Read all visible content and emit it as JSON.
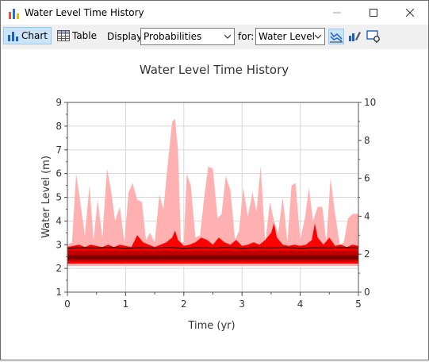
{
  "window": {
    "title": "Water Level Time History"
  },
  "toolbar": {
    "chart_label": "Chart",
    "table_label": "Table",
    "display_label": "Display:",
    "display_value": "Probabilities",
    "for_label": "for:",
    "for_value": "Water Level"
  },
  "chart_data": {
    "type": "area",
    "title": "Water Level Time History",
    "xlabel": "Time (yr)",
    "ylabel": "Water Level (m)",
    "xlim": [
      0,
      5
    ],
    "ylim": [
      1,
      9
    ],
    "y2lim": [
      0,
      10
    ],
    "xticks": [
      "0",
      "1",
      "2",
      "3",
      "4",
      "5"
    ],
    "yticks": [
      "1",
      "2",
      "3",
      "4",
      "5",
      "6",
      "7",
      "8",
      "9"
    ],
    "y2ticks": [
      "0",
      "2",
      "4",
      "6",
      "8",
      "10"
    ],
    "grid": true,
    "colors": {
      "outer_band": "#ffb0b0",
      "mid_band": "#ff0000",
      "inner_band": "#c00000",
      "core_band": "#7a0000",
      "median_line": "#000000"
    },
    "series": [
      {
        "band": "outer",
        "x": [
          0,
          0.08,
          0.15,
          0.22,
          0.3,
          0.38,
          0.45,
          0.52,
          0.6,
          0.68,
          0.75,
          0.82,
          0.9,
          0.98,
          1.05,
          1.12,
          1.2,
          1.28,
          1.35,
          1.42,
          1.5,
          1.58,
          1.65,
          1.72,
          1.8,
          1.85,
          1.9,
          1.95,
          2.0,
          2.05,
          2.12,
          2.2,
          2.28,
          2.35,
          2.42,
          2.5,
          2.58,
          2.65,
          2.72,
          2.8,
          2.88,
          2.95,
          3.02,
          3.1,
          3.18,
          3.25,
          3.32,
          3.4,
          3.48,
          3.55,
          3.62,
          3.7,
          3.78,
          3.85,
          3.92,
          4.0,
          4.08,
          4.15,
          4.22,
          4.3,
          4.38,
          4.45,
          4.52,
          4.6,
          4.68,
          4.75,
          4.82,
          4.9,
          5.0
        ],
        "upper": [
          3.0,
          3.1,
          6.0,
          4.8,
          3.4,
          5.5,
          3.2,
          4.9,
          3.3,
          6.2,
          5.3,
          4.0,
          4.6,
          3.1,
          5.2,
          5.6,
          4.9,
          4.8,
          3.2,
          3.5,
          3.1,
          5.1,
          4.5,
          6.3,
          8.2,
          8.3,
          7.0,
          3.1,
          3.1,
          6.0,
          5.5,
          3.3,
          3.4,
          5.0,
          6.3,
          6.2,
          4.1,
          4.3,
          5.9,
          5.3,
          3.2,
          3.6,
          5.4,
          4.2,
          5.2,
          4.4,
          6.3,
          3.1,
          4.8,
          4.0,
          3.5,
          5.0,
          3.1,
          5.5,
          5.6,
          3.2,
          4.1,
          5.4,
          4.0,
          4.6,
          4.6,
          3.1,
          5.8,
          4.3,
          3.0,
          3.1,
          4.1,
          4.3,
          4.3
        ],
        "lower": [
          2.1,
          2.1,
          2.1,
          2.1,
          2.1,
          2.1,
          2.1,
          2.1,
          2.1,
          2.1,
          2.1,
          2.1,
          2.1,
          2.1,
          2.1,
          2.1,
          2.1,
          2.1,
          2.1,
          2.1,
          2.1,
          2.1,
          2.1,
          2.1,
          2.1,
          2.1,
          2.1,
          2.1,
          2.1,
          2.1,
          2.1,
          2.1,
          2.1,
          2.1,
          2.1,
          2.1,
          2.1,
          2.1,
          2.1,
          2.1,
          2.1,
          2.1,
          2.1,
          2.1,
          2.1,
          2.1,
          2.1,
          2.1,
          2.1,
          2.1,
          2.1,
          2.1,
          2.1,
          2.1,
          2.1,
          2.1,
          2.1,
          2.1,
          2.1,
          2.1,
          2.1,
          2.1,
          2.1,
          2.1,
          2.1,
          2.1,
          2.1,
          2.1,
          2.1
        ]
      },
      {
        "band": "mid",
        "x": [
          0,
          0.1,
          0.2,
          0.3,
          0.4,
          0.5,
          0.6,
          0.7,
          0.8,
          0.9,
          1.0,
          1.1,
          1.2,
          1.3,
          1.4,
          1.5,
          1.6,
          1.7,
          1.8,
          1.85,
          1.9,
          2.0,
          2.1,
          2.2,
          2.3,
          2.4,
          2.5,
          2.6,
          2.7,
          2.8,
          2.9,
          3.0,
          3.1,
          3.2,
          3.3,
          3.4,
          3.5,
          3.55,
          3.6,
          3.7,
          3.8,
          3.9,
          4.0,
          4.1,
          4.2,
          4.25,
          4.3,
          4.4,
          4.5,
          4.6,
          4.7,
          4.8,
          4.9,
          5.0
        ],
        "upper": [
          2.9,
          2.95,
          3.0,
          2.9,
          3.0,
          2.95,
          2.9,
          3.0,
          2.9,
          3.0,
          2.95,
          2.9,
          3.4,
          3.1,
          3.0,
          2.9,
          3.0,
          3.1,
          3.3,
          3.6,
          3.2,
          2.95,
          3.0,
          3.1,
          3.3,
          3.2,
          3.0,
          3.3,
          3.1,
          3.0,
          3.2,
          2.95,
          3.0,
          3.1,
          3.0,
          3.2,
          3.5,
          3.9,
          3.3,
          3.0,
          2.95,
          3.0,
          2.95,
          3.0,
          3.2,
          3.9,
          3.3,
          3.0,
          3.3,
          2.95,
          3.0,
          2.9,
          3.0,
          2.95
        ],
        "lower": [
          2.2,
          2.2,
          2.2,
          2.2,
          2.2,
          2.2,
          2.2,
          2.2,
          2.2,
          2.2,
          2.2,
          2.2,
          2.2,
          2.2,
          2.2,
          2.2,
          2.2,
          2.2,
          2.2,
          2.2,
          2.2,
          2.2,
          2.2,
          2.2,
          2.2,
          2.2,
          2.2,
          2.2,
          2.2,
          2.2,
          2.2,
          2.2,
          2.2,
          2.2,
          2.2,
          2.2,
          2.2,
          2.2,
          2.2,
          2.2,
          2.2,
          2.2,
          2.2,
          2.2,
          2.2,
          2.2,
          2.2,
          2.2,
          2.2,
          2.2,
          2.2,
          2.2,
          2.2,
          2.2
        ]
      },
      {
        "band": "inner",
        "x": [
          0,
          0.5,
          1.0,
          1.5,
          2.0,
          2.5,
          3.0,
          3.5,
          4.0,
          4.5,
          5.0
        ],
        "upper": [
          2.75,
          2.75,
          2.75,
          2.75,
          2.75,
          2.75,
          2.75,
          2.75,
          2.75,
          2.75,
          2.75
        ],
        "lower": [
          2.3,
          2.3,
          2.3,
          2.3,
          2.3,
          2.3,
          2.3,
          2.3,
          2.3,
          2.3,
          2.3
        ]
      },
      {
        "band": "core",
        "x": [
          0,
          0.5,
          1.0,
          1.5,
          2.0,
          2.5,
          3.0,
          3.5,
          4.0,
          4.5,
          5.0
        ],
        "upper": [
          2.55,
          2.55,
          2.55,
          2.55,
          2.55,
          2.55,
          2.55,
          2.55,
          2.55,
          2.55,
          2.55
        ],
        "lower": [
          2.38,
          2.38,
          2.38,
          2.38,
          2.38,
          2.38,
          2.38,
          2.38,
          2.38,
          2.38,
          2.38
        ]
      },
      {
        "band": "median",
        "x": [
          0,
          0.25,
          0.5,
          0.75,
          1.0,
          1.25,
          1.5,
          1.75,
          2.0,
          2.25,
          2.5,
          2.75,
          3.0,
          3.25,
          3.5,
          3.75,
          4.0,
          4.25,
          4.5,
          4.75,
          5.0
        ],
        "values": [
          2.85,
          2.87,
          2.86,
          2.88,
          2.85,
          2.87,
          2.86,
          2.88,
          2.85,
          2.87,
          2.86,
          2.88,
          2.85,
          2.87,
          2.86,
          2.88,
          2.85,
          2.87,
          2.86,
          2.88,
          2.86
        ]
      }
    ]
  }
}
